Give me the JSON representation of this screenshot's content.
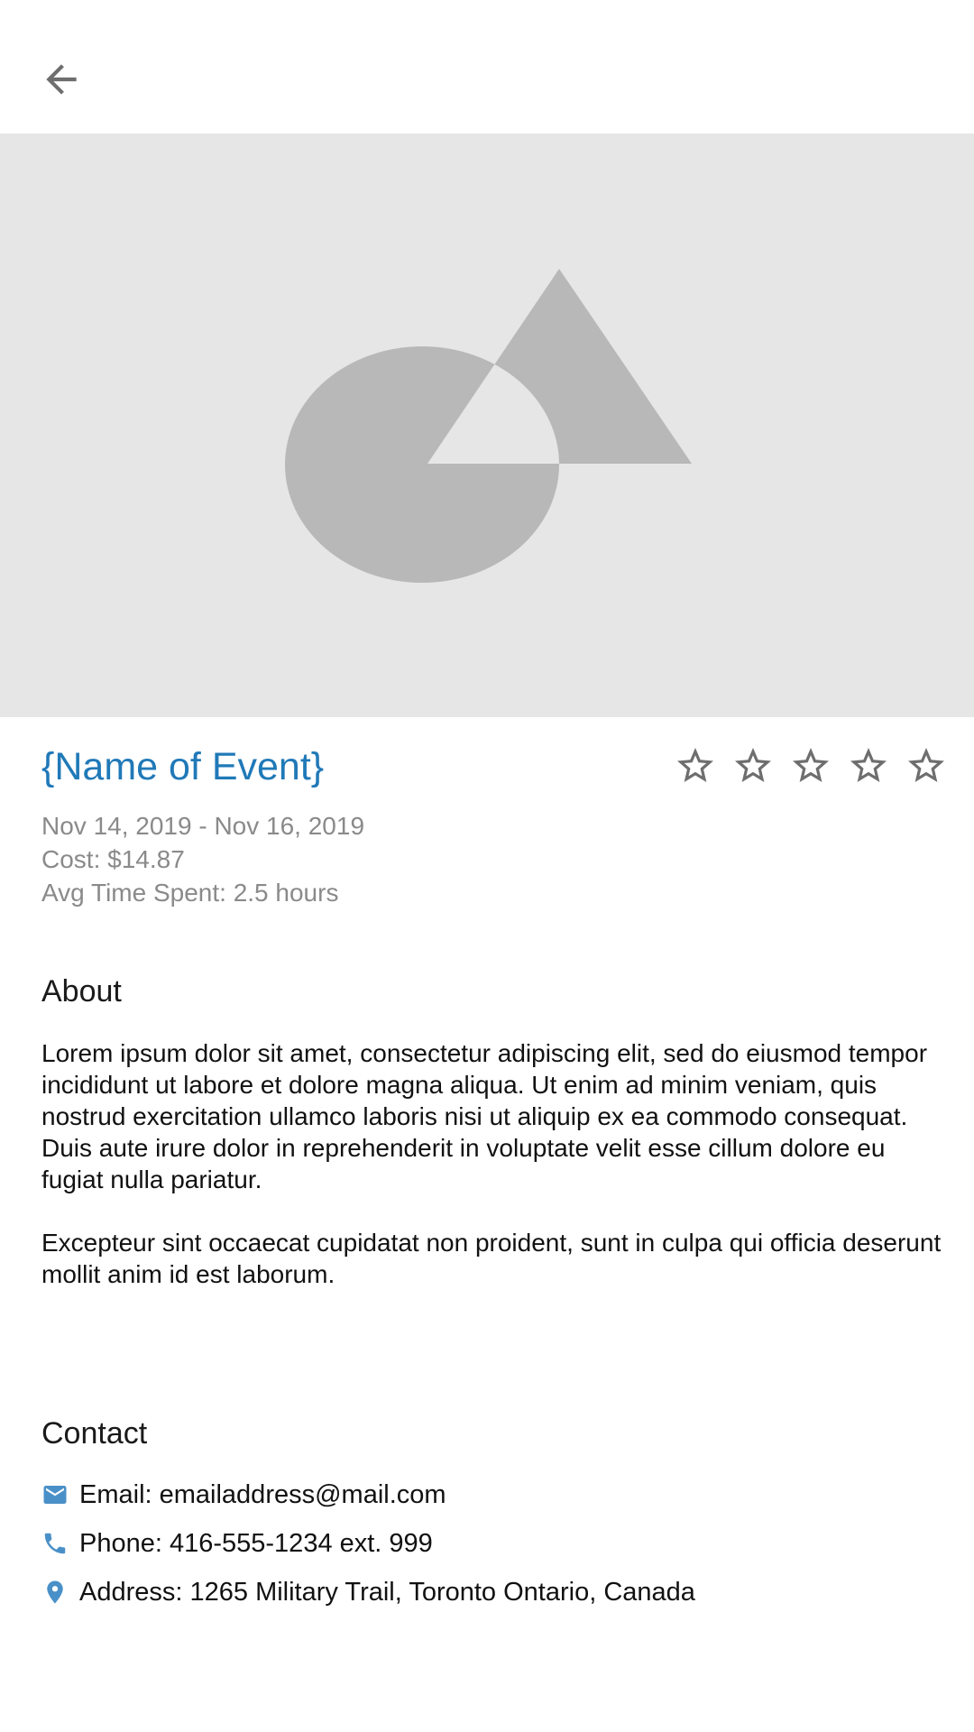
{
  "header": {
    "back_icon": "arrow-left-icon"
  },
  "hero": {
    "image_icon": "placeholder-image-icon"
  },
  "event": {
    "name": "{Name of Event}",
    "dates": "Nov 14, 2019 - Nov 16, 2019",
    "cost": "Cost: $14.87",
    "avg_time": "Avg Time Spent: 2.5 hours",
    "rating": {
      "value": 0,
      "max": 5
    }
  },
  "about": {
    "title": "About",
    "paragraphs": [
      "Lorem ipsum dolor sit amet, consectetur adipiscing elit, sed do eiusmod tempor incididunt ut labore et dolore magna aliqua. Ut enim ad minim veniam, quis nostrud exercitation ullamco laboris nisi ut aliquip ex ea commodo consequat. Duis aute irure dolor in reprehenderit in voluptate velit esse cillum dolore eu fugiat nulla pariatur.",
      "Excepteur sint occaecat cupidatat non proident, sunt in culpa qui officia deserunt mollit anim id est laborum."
    ]
  },
  "contact": {
    "title": "Contact",
    "email": "Email: emailaddress@mail.com",
    "phone": "Phone: 416-555-1234 ext. 999",
    "address": "Address: 1265 Military Trail, Toronto Ontario, Canada"
  },
  "colors": {
    "accent": "#2079b8",
    "icon_blue": "#4a90c8",
    "hero_bg": "#e6e6e6",
    "hero_shape": "#b8b8b8",
    "meta_text": "#8a8a8a"
  }
}
